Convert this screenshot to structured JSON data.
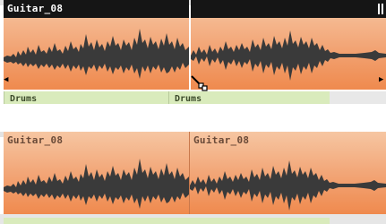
{
  "top_panel": {
    "events": [
      {
        "name": "Guitar_08",
        "state": "selected"
      },
      {
        "name": "",
        "state": "selected"
      }
    ],
    "below_track_labels": [
      "Drums",
      "Drums"
    ]
  },
  "bottom_panel": {
    "events": [
      {
        "name": "Guitar_08",
        "state": "normal"
      },
      {
        "name": "Guitar_08",
        "state": "normal"
      }
    ]
  },
  "icons": {
    "pause": "pause-icon",
    "left_marker": "triangle-left-icon",
    "right_marker": "triangle-right-icon",
    "cursor": "scissors-cursor-icon"
  },
  "colors": {
    "event_top": "#f6c6a2",
    "event_bottom": "#ef8a4e",
    "waveform": "#3a3a3a",
    "name_bar_selected": "#151515",
    "drums_clip": "#d9ebbc"
  }
}
